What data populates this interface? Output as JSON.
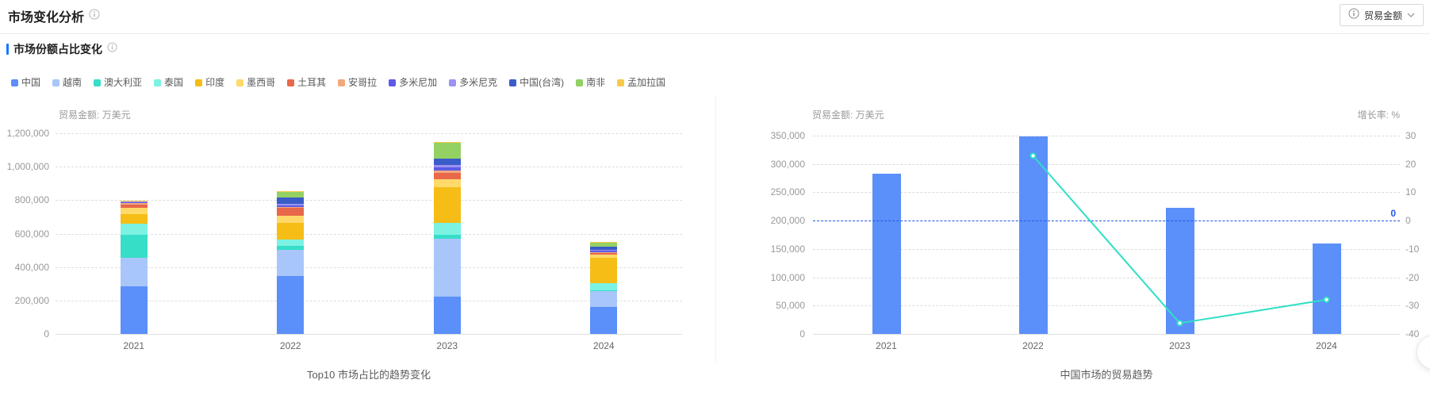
{
  "header": {
    "title": "市场变化分析",
    "info_icon": "info-circle-icon",
    "selector": {
      "label": "贸易金额",
      "info_icon": "info-circle-icon",
      "chevron_icon": "chevron-down-icon"
    }
  },
  "section": {
    "title": "市场份额占比变化",
    "info_icon": "info-circle-icon"
  },
  "colors": {
    "accent": "#1677ff",
    "bar_blue": "#5B8FF9",
    "line_teal": "#2FE0C5",
    "markline_blue": "#2458E5",
    "grid": "#dddddd",
    "axis_text": "#999999",
    "category_text": "#666666",
    "legend_text": "#595959"
  },
  "back_to_top_icon": "arrow-up-to-top-icon",
  "chart_data": [
    {
      "type": "bar",
      "stacked": true,
      "title": "Top10 市场占比的趋势变化",
      "unit_label": "贸易金额: 万美元",
      "legend_position": "top",
      "grid": true,
      "categories": [
        "2021",
        "2022",
        "2023",
        "2024"
      ],
      "ylim": [
        0,
        1200000
      ],
      "ytick_labels": [
        "0",
        "200,000",
        "400,000",
        "600,000",
        "800,000",
        "1,000,000",
        "1,200,000"
      ],
      "series": [
        {
          "name": "中国",
          "color": "#5B8FF9",
          "values": [
            283000,
            346000,
            222000,
            160000
          ]
        },
        {
          "name": "越南",
          "color": "#A8C6FA",
          "values": [
            172000,
            159000,
            345000,
            95000
          ]
        },
        {
          "name": "澳大利亚",
          "color": "#36DEC8",
          "values": [
            140000,
            20000,
            25000,
            8000
          ]
        },
        {
          "name": "泰国",
          "color": "#7CF2E2",
          "values": [
            63000,
            40000,
            70000,
            40000
          ]
        },
        {
          "name": "印度",
          "color": "#F5BD16",
          "values": [
            57000,
            98000,
            215000,
            150000
          ]
        },
        {
          "name": "墨西哥",
          "color": "#FFD96A",
          "values": [
            41000,
            44000,
            50000,
            20000
          ]
        },
        {
          "name": "土耳其",
          "color": "#E8684A",
          "values": [
            19000,
            48000,
            35000,
            10000
          ]
        },
        {
          "name": "安哥拉",
          "color": "#F2A87E",
          "values": [
            8000,
            4000,
            15000,
            5000
          ]
        },
        {
          "name": "多米尼加",
          "color": "#5D5BE5",
          "values": [
            5000,
            10000,
            20000,
            8000
          ]
        },
        {
          "name": "多米尼克",
          "color": "#9B93F2",
          "values": [
            4000,
            10000,
            15000,
            6000
          ]
        },
        {
          "name": "中国(台湾)",
          "color": "#3A5CC8",
          "values": [
            3000,
            38000,
            35000,
            18000
          ]
        },
        {
          "name": "南非",
          "color": "#94D163",
          "values": [
            2000,
            33000,
            95000,
            25000
          ]
        },
        {
          "name": "孟加拉国",
          "color": "#F9C94A",
          "values": [
            2000,
            2000,
            8000,
            5000
          ]
        }
      ]
    },
    {
      "type": "bar+line",
      "title": "中国市场的贸易趋势",
      "unit_label_left": "贸易金额: 万美元",
      "unit_label_right": "增长率: %",
      "grid": true,
      "categories": [
        "2021",
        "2022",
        "2023",
        "2024"
      ],
      "bar_series": {
        "name": "贸易金额",
        "color": "#5B8FF9",
        "values": [
          283000,
          348000,
          222000,
          160000
        ]
      },
      "line_series": {
        "name": "增长率",
        "color": "#2FE0C5",
        "values": [
          null,
          22.9,
          -36.2,
          -27.9
        ]
      },
      "ylim_left": [
        0,
        350000
      ],
      "ytick_labels_left": [
        "0",
        "50,000",
        "100,000",
        "150,000",
        "200,000",
        "250,000",
        "300,000",
        "350,000"
      ],
      "ylim_right": [
        -40,
        30
      ],
      "ytick_labels_right": [
        "30",
        "20",
        "10",
        "0",
        "-10",
        "-20",
        "-30",
        "-40"
      ],
      "markline": {
        "value_left": 200000,
        "value_right": 0,
        "label": "0",
        "color": "#2458E5"
      }
    }
  ]
}
